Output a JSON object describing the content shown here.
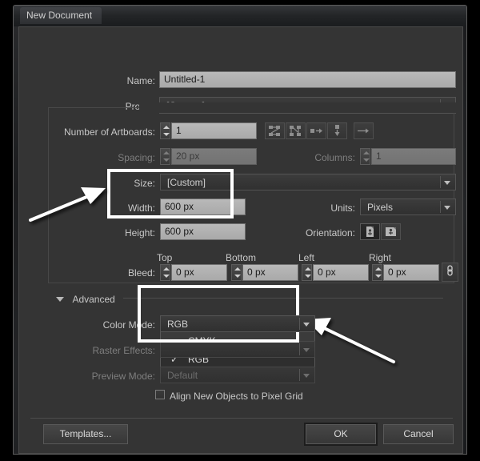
{
  "window": {
    "title": "New Document"
  },
  "fields": {
    "name": {
      "label": "Name:",
      "value": "Untitled-1"
    },
    "profile": {
      "label": "Profile:",
      "value": "[Custom]"
    },
    "artboards": {
      "label": "Number of Artboards:",
      "value": "1"
    },
    "spacing": {
      "label": "Spacing:",
      "value": "20 px"
    },
    "columns": {
      "label": "Columns:",
      "value": "1"
    },
    "size": {
      "label": "Size:",
      "value": "[Custom]"
    },
    "width": {
      "label": "Width:",
      "value": "600 px"
    },
    "height": {
      "label": "Height:",
      "value": "600 px"
    },
    "units": {
      "label": "Units:",
      "value": "Pixels"
    },
    "orientation": {
      "label": "Orientation:"
    },
    "bleed": {
      "label": "Bleed:",
      "columns": [
        "Top",
        "Bottom",
        "Left",
        "Right"
      ],
      "values": [
        "0 px",
        "0 px",
        "0 px",
        "0 px"
      ]
    }
  },
  "advanced": {
    "label": "Advanced",
    "color_mode": {
      "label": "Color Mode:",
      "value": "RGB",
      "options": [
        "CMYK",
        "RGB"
      ],
      "checked": "RGB",
      "hovered": "CMYK",
      "check_glyph": "✓"
    },
    "raster_effects": {
      "label": "Raster Effects:",
      "value": ""
    },
    "preview_mode": {
      "label": "Preview Mode:",
      "value": "Default"
    },
    "align_pixel_grid": {
      "label": "Align New Objects to Pixel Grid",
      "checked": false
    }
  },
  "footer": {
    "templates": "Templates...",
    "ok": "OK",
    "cancel": "Cancel"
  },
  "icons": {
    "artboard_arrange": [
      "grid-by-row-icon",
      "grid-by-column-icon",
      "arrange-by-row-icon",
      "arrange-by-column-icon"
    ],
    "artboard_direction": "left-to-right-icon",
    "orientation_portrait": "portrait-icon",
    "orientation_landscape": "landscape-icon",
    "bleed_link": "link-chain-icon",
    "advanced_disclosure": "triangle-down-icon"
  },
  "annotations": {
    "highlight_boxes": [
      "width-height-highlight",
      "color-mode-highlight"
    ],
    "arrows": [
      "arrow-to-width-height",
      "arrow-to-color-mode-dropdown"
    ]
  },
  "colors": {
    "panel_bg": "#343434",
    "input_bg": "#b2b2b2",
    "annotation": "#ffffff"
  }
}
